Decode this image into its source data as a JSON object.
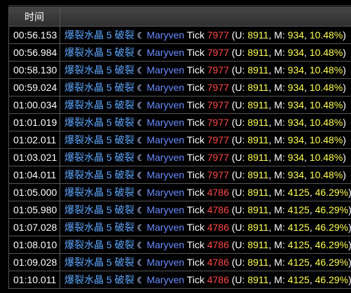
{
  "header": {
    "time_col": "时间",
    "text_col": ""
  },
  "colors": {
    "spell": "#5fa8ff",
    "target": "#6a8cff",
    "tick_amount": "#ff4a4a",
    "stat_values": "#ffff55",
    "text": "#ffffff"
  },
  "icons": {
    "spell_effect": "moon-icon"
  },
  "rows": [
    {
      "time": "00:56.153",
      "spell": "爆裂水晶 5 破裂",
      "target": "Maryven",
      "label": "Tick",
      "amount": "7977",
      "u": "8911",
      "m": "934",
      "pct": "10.48%"
    },
    {
      "time": "00:56.984",
      "spell": "爆裂水晶 5 破裂",
      "target": "Maryven",
      "label": "Tick",
      "amount": "7977",
      "u": "8911",
      "m": "934",
      "pct": "10.48%"
    },
    {
      "time": "00:58.130",
      "spell": "爆裂水晶 5 破裂",
      "target": "Maryven",
      "label": "Tick",
      "amount": "7977",
      "u": "8911",
      "m": "934",
      "pct": "10.48%"
    },
    {
      "time": "00:59.024",
      "spell": "爆裂水晶 5 破裂",
      "target": "Maryven",
      "label": "Tick",
      "amount": "7977",
      "u": "8911",
      "m": "934",
      "pct": "10.48%"
    },
    {
      "time": "01:00.034",
      "spell": "爆裂水晶 5 破裂",
      "target": "Maryven",
      "label": "Tick",
      "amount": "7977",
      "u": "8911",
      "m": "934",
      "pct": "10.48%"
    },
    {
      "time": "01:01.019",
      "spell": "爆裂水晶 5 破裂",
      "target": "Maryven",
      "label": "Tick",
      "amount": "7977",
      "u": "8911",
      "m": "934",
      "pct": "10.48%"
    },
    {
      "time": "01:02.011",
      "spell": "爆裂水晶 5 破裂",
      "target": "Maryven",
      "label": "Tick",
      "amount": "7977",
      "u": "8911",
      "m": "934",
      "pct": "10.48%"
    },
    {
      "time": "01:03.021",
      "spell": "爆裂水晶 5 破裂",
      "target": "Maryven",
      "label": "Tick",
      "amount": "7977",
      "u": "8911",
      "m": "934",
      "pct": "10.48%"
    },
    {
      "time": "01:04.011",
      "spell": "爆裂水晶 5 破裂",
      "target": "Maryven",
      "label": "Tick",
      "amount": "7977",
      "u": "8911",
      "m": "934",
      "pct": "10.48%"
    },
    {
      "time": "01:05.000",
      "spell": "爆裂水晶 5 破裂",
      "target": "Maryven",
      "label": "Tick",
      "amount": "4786",
      "u": "8911",
      "m": "4125",
      "pct": "46.29%"
    },
    {
      "time": "01:05.980",
      "spell": "爆裂水晶 5 破裂",
      "target": "Maryven",
      "label": "Tick",
      "amount": "4786",
      "u": "8911",
      "m": "4125",
      "pct": "46.29%"
    },
    {
      "time": "01:07.028",
      "spell": "爆裂水晶 5 破裂",
      "target": "Maryven",
      "label": "Tick",
      "amount": "4786",
      "u": "8911",
      "m": "4125",
      "pct": "46.29%"
    },
    {
      "time": "01:08.010",
      "spell": "爆裂水晶 5 破裂",
      "target": "Maryven",
      "label": "Tick",
      "amount": "4786",
      "u": "8911",
      "m": "4125",
      "pct": "46.29%"
    },
    {
      "time": "01:09.028",
      "spell": "爆裂水晶 5 破裂",
      "target": "Maryven",
      "label": "Tick",
      "amount": "4786",
      "u": "8911",
      "m": "4125",
      "pct": "46.29%"
    },
    {
      "time": "01:10.011",
      "spell": "爆裂水晶 5 破裂",
      "target": "Maryven",
      "label": "Tick",
      "amount": "4786",
      "u": "8911",
      "m": "4125",
      "pct": "46.29%"
    }
  ]
}
